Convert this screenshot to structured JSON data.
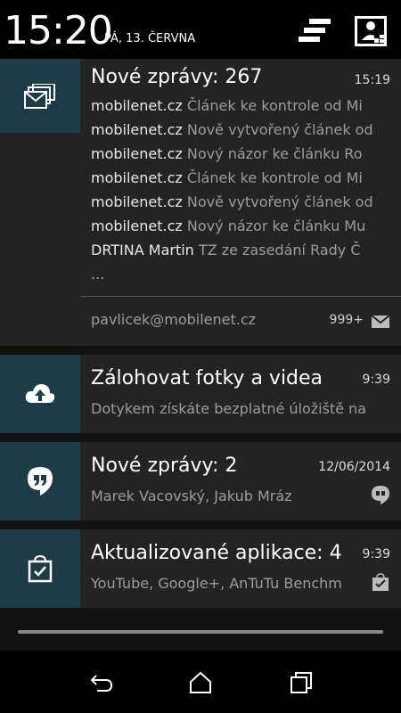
{
  "status": {
    "clock": "15:20",
    "date": "PÁ, 13. ČERVNA",
    "icons": [
      "notification-list-icon",
      "quick-settings-icon"
    ]
  },
  "notifications": {
    "gmail": {
      "icon": "gmail-icon",
      "title": "Nové zprávy: 267",
      "time": "15:19",
      "lines": [
        {
          "sender": "mobilenet.cz",
          "text": "Článek ke kontrole od Mi"
        },
        {
          "sender": "mobilenet.cz",
          "text": "Nově vytvořený článek od"
        },
        {
          "sender": "mobilenet.cz",
          "text": "Nový názor ke článku Ro"
        },
        {
          "sender": "mobilenet.cz",
          "text": "Článek ke kontrole od Mi"
        },
        {
          "sender": "mobilenet.cz",
          "text": "Nově vytvořený článek od"
        },
        {
          "sender": "mobilenet.cz",
          "text": "Nový názor ke článku Mu"
        },
        {
          "sender": "DRTINA Martin",
          "text": "TZ ze zasedání Rady Č"
        }
      ],
      "more": "...",
      "account": "pavlicek@mobilenet.cz",
      "count": "999+",
      "count_icon": "mail-icon"
    },
    "backup": {
      "icon": "cloud-upload-icon",
      "title": "Zálohovat fotky a videa",
      "time": "9:39",
      "sub": "Dotykem získáte bezplatné úložiště na"
    },
    "hangouts": {
      "icon": "hangouts-icon",
      "title": "Nové zprávy: 2",
      "time": "12/06/2014",
      "sub": "Marek Vacovský, Jakub Mráz",
      "small_icon": "hangouts-small-icon"
    },
    "updates": {
      "icon": "play-store-bag-icon",
      "title": "Aktualizované aplikace: 4",
      "time": "9:39",
      "sub": "YouTube, Google+, AnTuTu Benchm",
      "small_icon": "bag-check-small-icon"
    }
  },
  "colors": {
    "icon_box": "#1f3b48",
    "card": "#232323",
    "shade": "#121212"
  },
  "navbar": {
    "icons": [
      "back-icon",
      "home-icon",
      "recents-icon"
    ]
  }
}
